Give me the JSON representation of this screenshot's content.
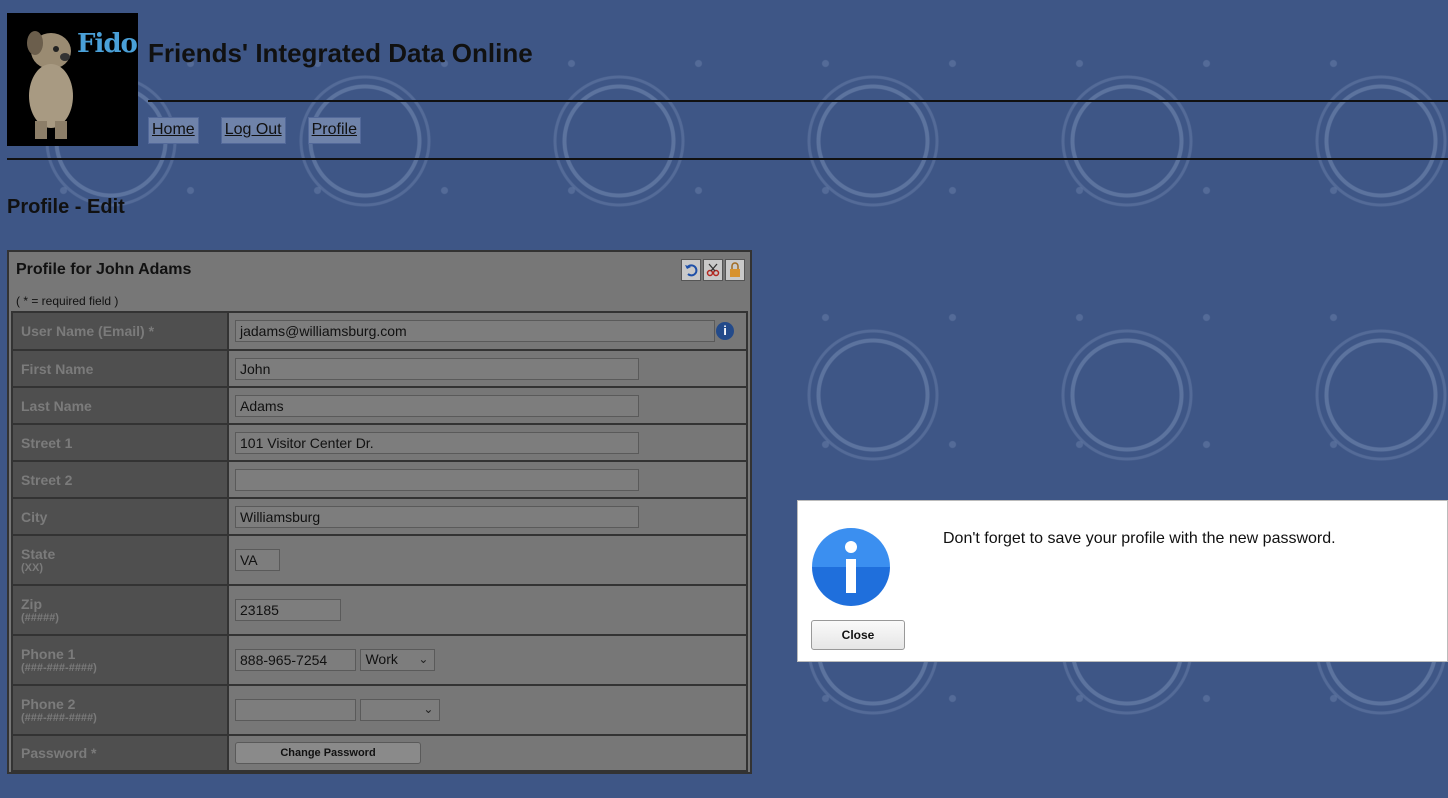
{
  "header": {
    "logo_text": "Fido",
    "site_title": "Friends' Integrated Data Online",
    "nav": [
      "Home",
      "Log Out",
      "Profile"
    ]
  },
  "page": {
    "title": "Profile - Edit"
  },
  "panel": {
    "title": "Profile for John Adams",
    "required_note": "( * = required field )",
    "tool_icons": [
      "undo-icon",
      "scissors-icon",
      "lock-icon"
    ]
  },
  "form": {
    "username": {
      "label": "User Name (Email) *",
      "value": "jadams@williamsburg.com"
    },
    "first_name": {
      "label": "First Name",
      "value": "John"
    },
    "last_name": {
      "label": "Last Name",
      "value": "Adams"
    },
    "street1": {
      "label": "Street 1",
      "value": "101 Visitor Center Dr."
    },
    "street2": {
      "label": "Street 2",
      "value": ""
    },
    "city": {
      "label": "City",
      "value": "Williamsburg"
    },
    "state": {
      "label": "State",
      "sub": "(XX)",
      "value": "VA"
    },
    "zip": {
      "label": "Zip",
      "sub": "(#####)",
      "value": "23185"
    },
    "phone1": {
      "label": "Phone 1",
      "sub": "(###-###-####)",
      "value": "888-965-7254",
      "type": "Work"
    },
    "phone2": {
      "label": "Phone 2",
      "sub": "(###-###-####)",
      "value": "",
      "type": ""
    },
    "password": {
      "label": "Password *",
      "button": "Change Password"
    }
  },
  "dialog": {
    "message": "Don't forget to save your profile with the new password.",
    "close_label": "Close"
  },
  "colors": {
    "background": "#3e5686",
    "dialog_icon": "#1f6fdc"
  }
}
